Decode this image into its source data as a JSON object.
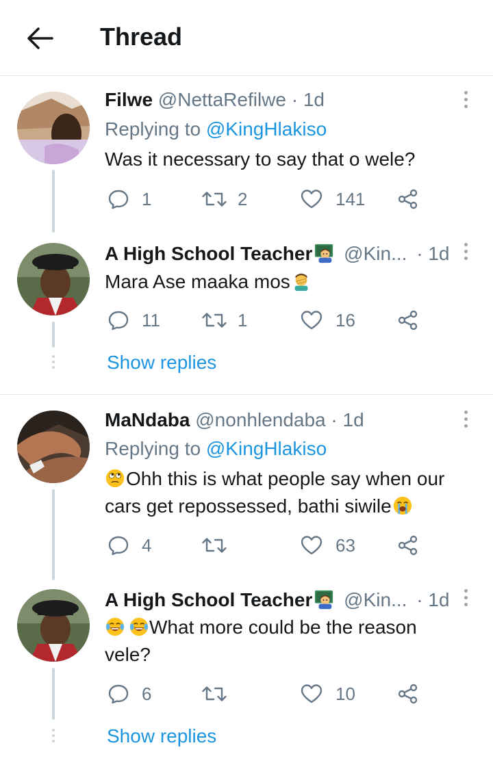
{
  "header": {
    "title": "Thread"
  },
  "tweets": [
    {
      "name": "Filwe",
      "handle": "@NettaRefilwe",
      "time": "· 1d",
      "replying_prefix": "Replying to ",
      "replying_to": "@KingHlakiso",
      "text": "Was it necessary to say that o wele?",
      "replies": "1",
      "retweets": "2",
      "likes": "141"
    },
    {
      "name": "A High School Teacher",
      "handle": "@Kin...",
      "time": "· 1d",
      "text": "Mara Ase maaka mos",
      "replies": "11",
      "retweets": "1",
      "likes": "16",
      "show_replies": "Show replies"
    },
    {
      "name": "MaNdaba",
      "handle": "@nonhlendaba",
      "time": "· 1d",
      "replying_prefix": "Replying to ",
      "replying_to": "@KingHlakiso",
      "text_line1": "Ohh this is what people say when our",
      "text_line2": "cars get repossessed, bathi siwile",
      "replies": "4",
      "retweets": "",
      "likes": "63"
    },
    {
      "name": "A High School Teacher",
      "handle": "@Kin...",
      "time": "· 1d",
      "text_line1": "What more could be the reason",
      "text_line2": "vele?",
      "replies": "6",
      "retweets": "",
      "likes": "10",
      "show_replies": "Show replies"
    }
  ],
  "icons": [
    "back-arrow-icon",
    "reply-icon",
    "retweet-icon",
    "like-icon",
    "share-icon",
    "more-options-icon",
    "teacher-emoji-icon",
    "facepalm-emoji-icon",
    "eye-roll-emoji-icon",
    "crying-emoji-icon",
    "laughing-emoji-icon"
  ],
  "colors": {
    "link": "#1b95e0",
    "secondary": "#657786",
    "primary": "#14171a",
    "thread_line": "#ccd6dd"
  }
}
